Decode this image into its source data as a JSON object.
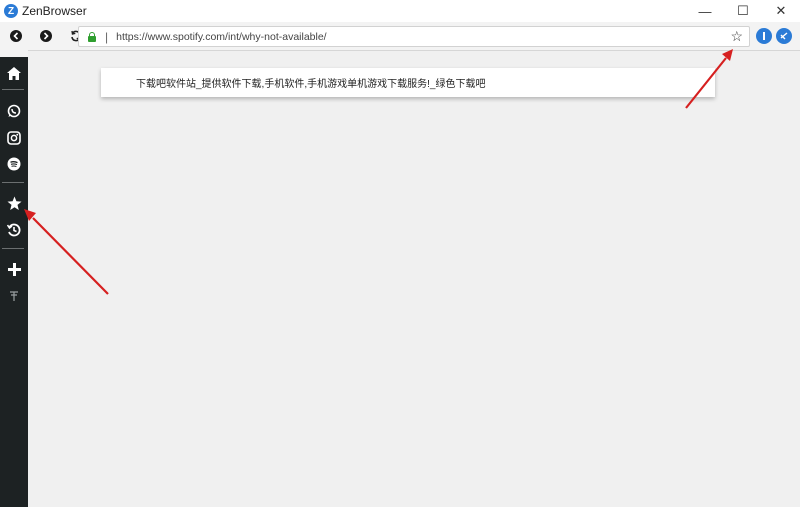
{
  "window": {
    "title": "ZenBrowser",
    "logo_letter": "Z",
    "controls": {
      "minimize": "—",
      "maximize": "☐",
      "close": "✕"
    }
  },
  "toolbar": {
    "back_icon": "left-arrow",
    "forward_icon": "right-arrow",
    "reload_icon": "refresh",
    "url": "https://www.spotify.com/int/why-not-available/",
    "separator": "|",
    "bookmark_icon": "☆",
    "ext1_label": "",
    "ext2_label": ""
  },
  "sidebar": {
    "items": [
      {
        "name": "home-icon"
      },
      {
        "name": "whatsapp-icon"
      },
      {
        "name": "instagram-icon"
      },
      {
        "name": "spotify-icon"
      },
      {
        "name": "star-icon"
      },
      {
        "name": "history-icon"
      },
      {
        "name": "plus-icon"
      },
      {
        "name": "antenna-icon"
      }
    ]
  },
  "content": {
    "page_text": "下载吧软件站_提供软件下载,手机软件,手机游戏单机游戏下载服务!_绿色下载吧"
  },
  "colors": {
    "sidebar_bg": "#1d2223",
    "lock_green": "#2f9e2f",
    "arrow_red": "#d62020",
    "ext_blue": "#2b7bd6"
  }
}
